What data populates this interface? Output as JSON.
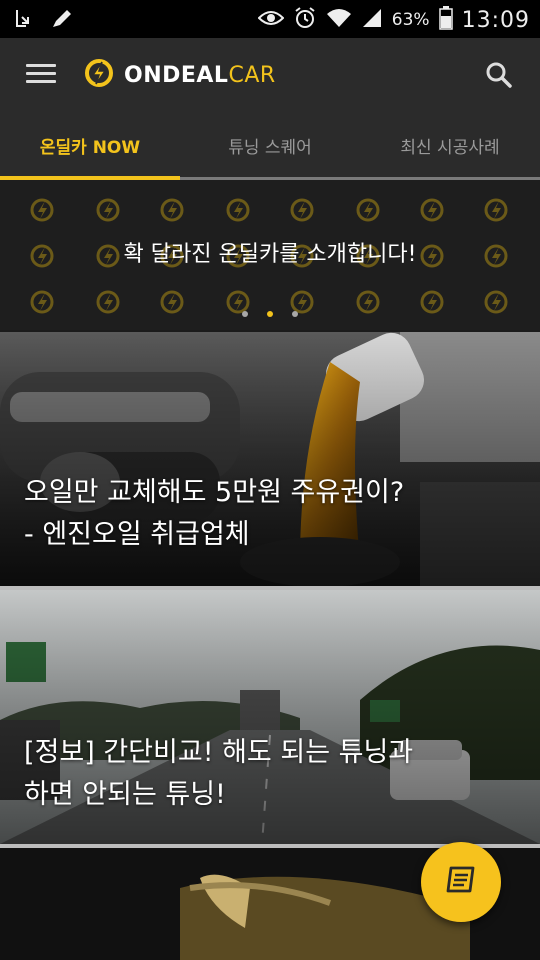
{
  "status_bar": {
    "battery_text": "63%",
    "time": "13:09"
  },
  "app": {
    "logo_word": "ONDEAL",
    "logo_car": "CAR"
  },
  "tabs": [
    {
      "label": "온딜카 NOW",
      "active": true
    },
    {
      "label": "튜닝 스퀘어",
      "active": false
    },
    {
      "label": "최신 시공사례",
      "active": false
    }
  ],
  "banner": {
    "text": "확 달라진 온딜카를 소개합니다!",
    "page_count": 3,
    "active_page": 2
  },
  "articles": [
    {
      "line1": "오일만 교체해도 5만원 주유권이?",
      "line2": "- 엔진오일 취급업체"
    },
    {
      "line1": "[정보] 간단비교! 해도 되는 튜닝과",
      "line2": "하면 안되는 튜닝!"
    }
  ],
  "colors": {
    "accent": "#f3c31c",
    "appbar": "#2b2b2b"
  }
}
